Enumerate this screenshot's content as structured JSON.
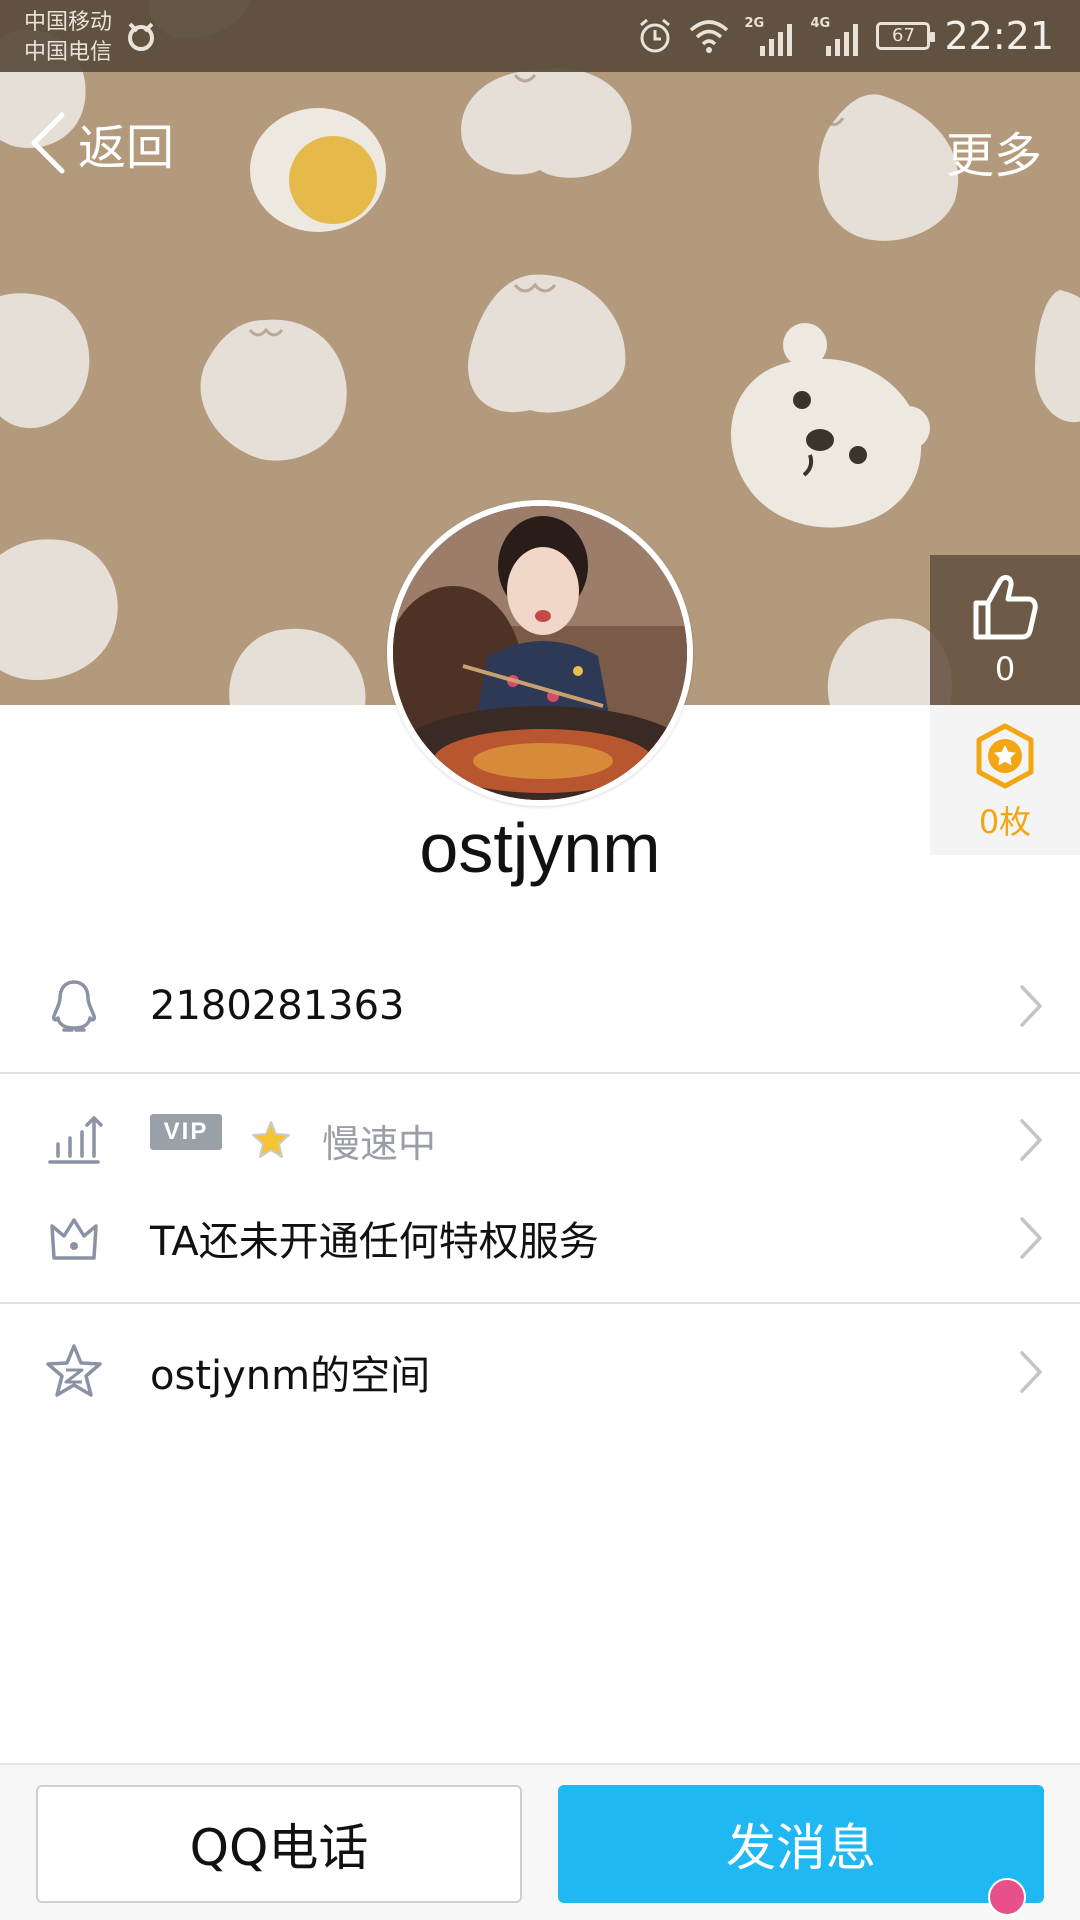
{
  "status_bar": {
    "carrier_1": "中国移动",
    "carrier_2": "中国电信",
    "battery": "67",
    "network_1": "2G",
    "network_2": "4G",
    "time": "22:21"
  },
  "nav": {
    "back_label": "返回",
    "more_label": "更多"
  },
  "profile": {
    "username": "ostjynm",
    "like_count": "0",
    "badge_count": "0枚"
  },
  "list": {
    "qq_number": "2180281363",
    "vip_badge": "VIP",
    "vip_status": "慢速中",
    "privilege_text": "TA还未开通任何特权服务",
    "space_label": "ostjynm的空间"
  },
  "actions": {
    "call_label": "QQ电话",
    "message_label": "发消息"
  },
  "colors": {
    "cover_bg": "#b49a7d",
    "primary_button": "#20b8f2",
    "badge_orange": "#f3a614"
  }
}
